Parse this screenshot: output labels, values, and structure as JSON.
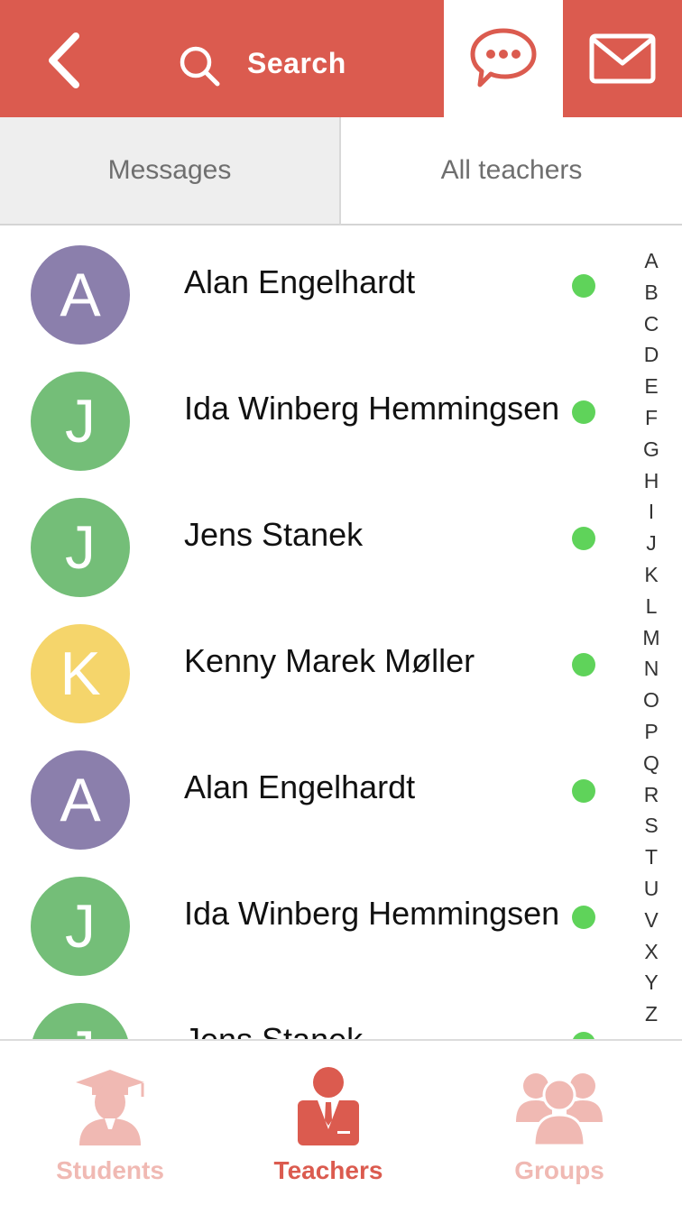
{
  "header": {
    "search_label": "Search",
    "back_icon": "chevron-left-icon",
    "search_icon": "search-icon",
    "chat_icon": "chat-bubble-icon",
    "mail_icon": "mail-icon",
    "accent_color": "#db5b4f"
  },
  "tabs": [
    {
      "label": "Messages",
      "active": false
    },
    {
      "label": "All teachers",
      "active": true
    }
  ],
  "teachers": [
    {
      "initial": "A",
      "name": "Alan Engelhardt",
      "color": "#8b7fac",
      "online": true
    },
    {
      "initial": "J",
      "name": "Ida Winberg Hemmingsen",
      "color": "#74be78",
      "online": true
    },
    {
      "initial": "J",
      "name": "Jens Stanek",
      "color": "#74be78",
      "online": true
    },
    {
      "initial": "K",
      "name": "Kenny Marek Møller",
      "color": "#f5d56b",
      "online": true
    },
    {
      "initial": "A",
      "name": "Alan Engelhardt",
      "color": "#8b7fac",
      "online": true
    },
    {
      "initial": "J",
      "name": "Ida Winberg Hemmingsen",
      "color": "#74be78",
      "online": true
    },
    {
      "initial": "J",
      "name": "Jens Stanek",
      "color": "#74be78",
      "online": true
    }
  ],
  "online_color": "#5fd35a",
  "index_letters": [
    "A",
    "B",
    "C",
    "D",
    "E",
    "F",
    "G",
    "H",
    "I",
    "J",
    "K",
    "L",
    "M",
    "N",
    "O",
    "P",
    "Q",
    "R",
    "S",
    "T",
    "U",
    "V",
    "X",
    "Y",
    "Z"
  ],
  "bottom_nav": [
    {
      "label": "Students",
      "icon": "student-graduate-icon",
      "active": false,
      "color": "#f0b9b3"
    },
    {
      "label": "Teachers",
      "icon": "teacher-icon",
      "active": true,
      "color": "#db5b4f"
    },
    {
      "label": "Groups",
      "icon": "group-icon",
      "active": false,
      "color": "#f0b9b3"
    }
  ]
}
